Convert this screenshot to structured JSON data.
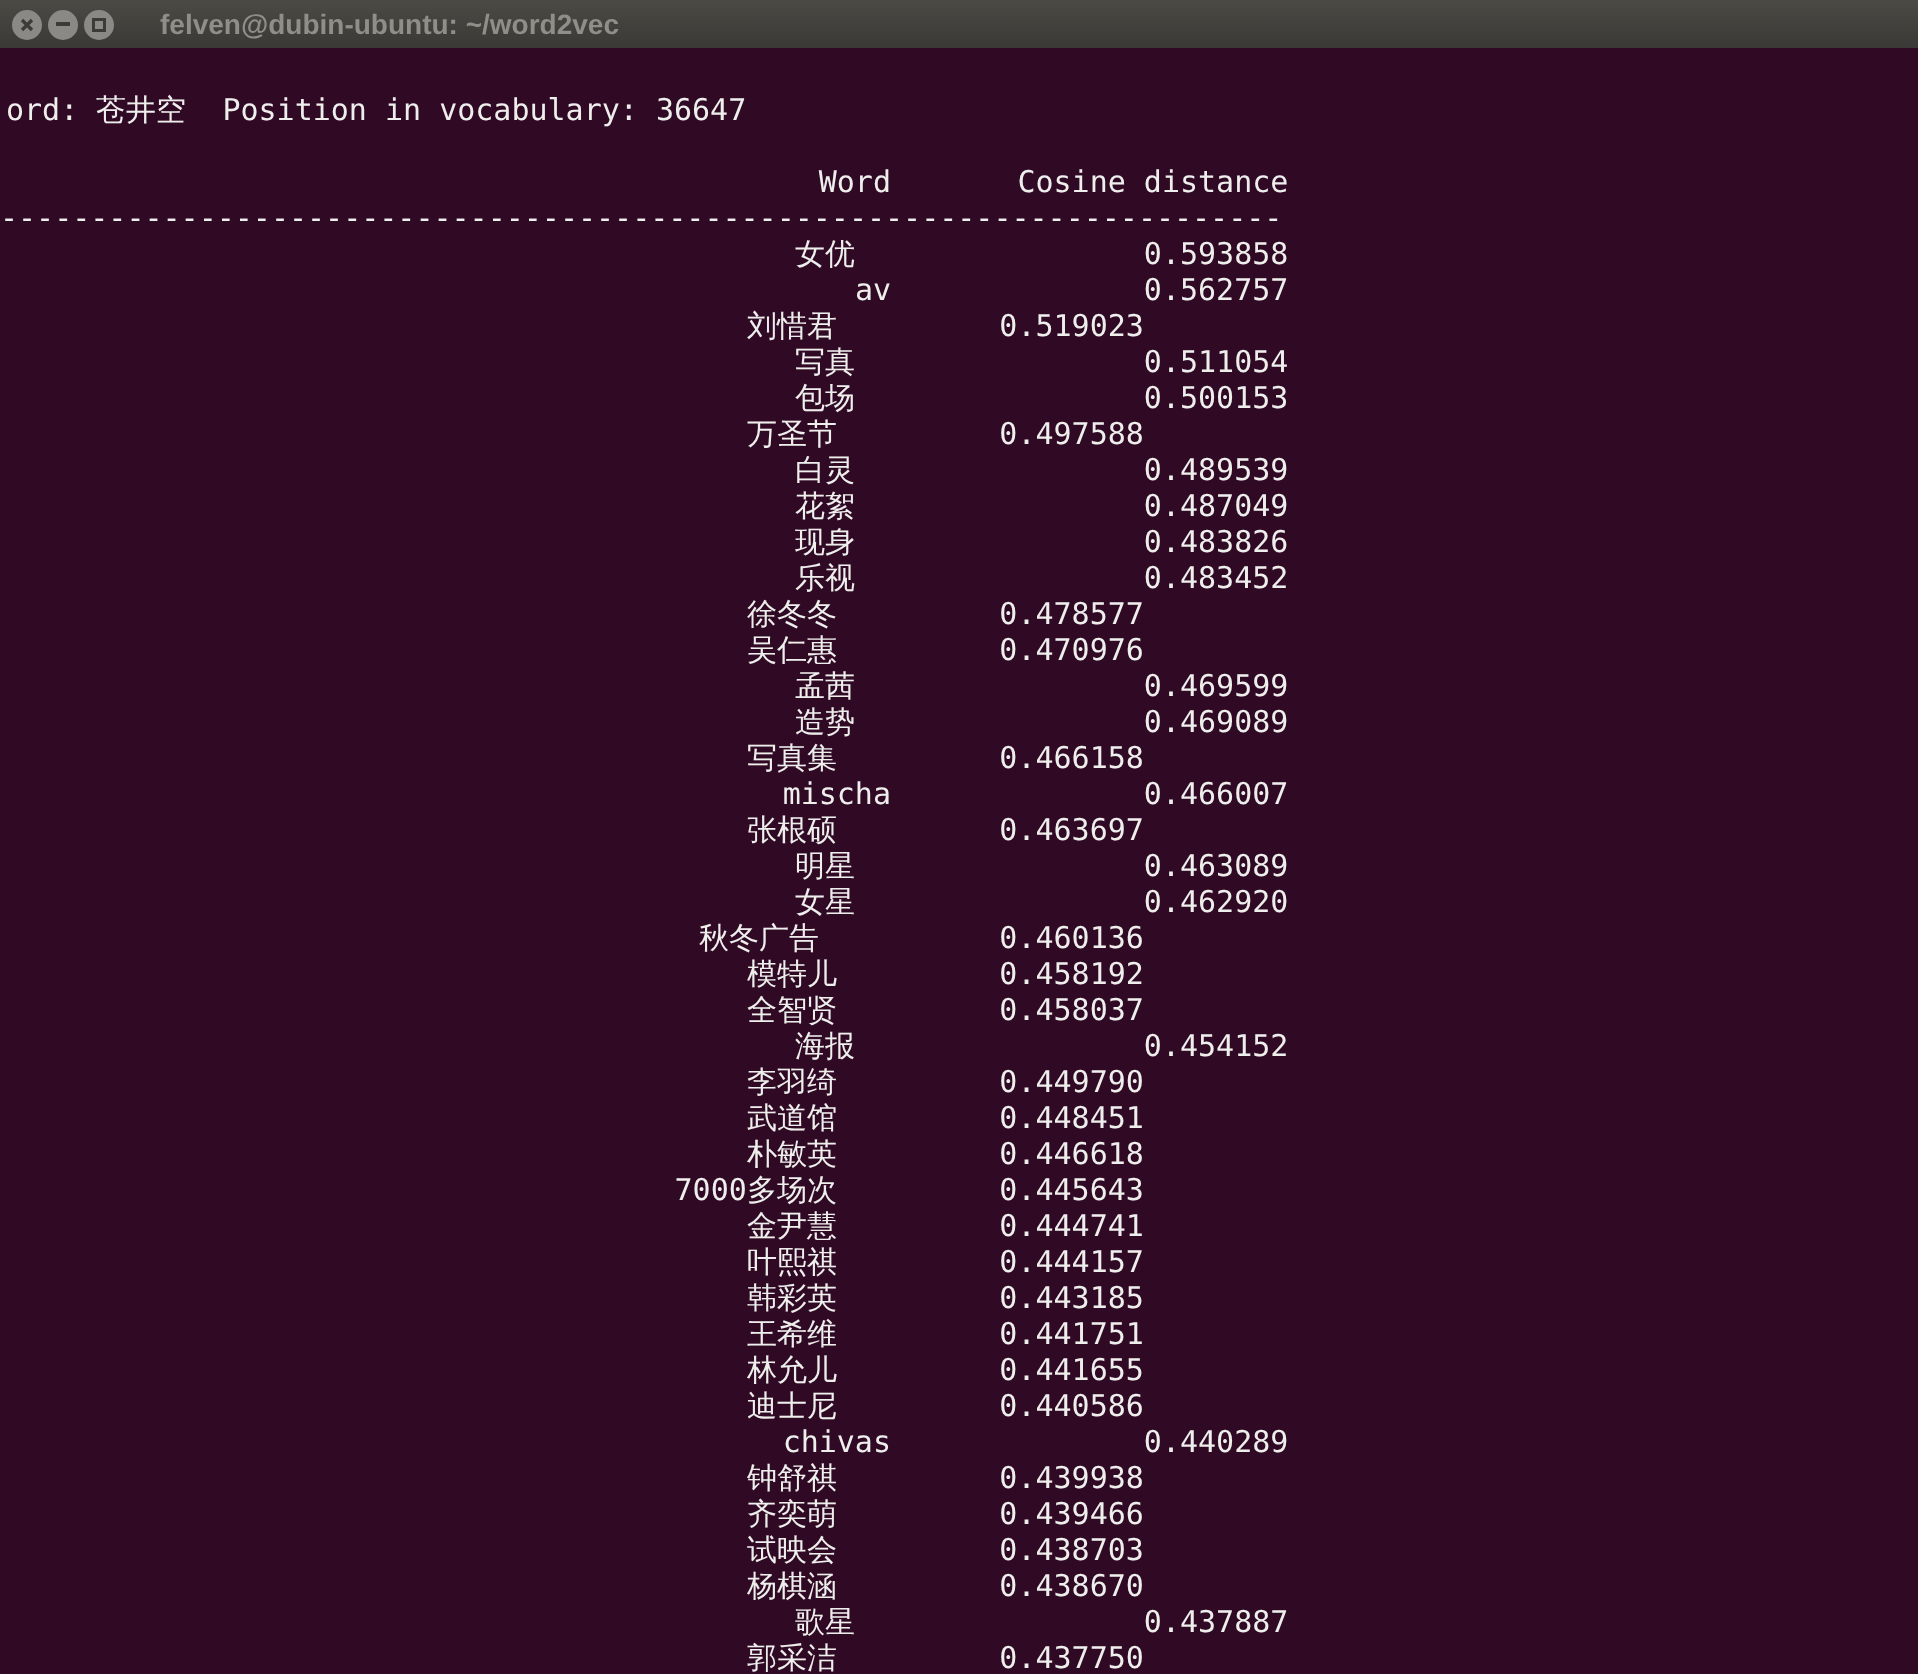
{
  "window": {
    "title": "felven@dubin-ubuntu: ~/word2vec"
  },
  "terminal": {
    "query_line": "ord: 苍井空  Position in vocabulary: 36647",
    "columns": [
      "Word",
      "Cosine distance"
    ],
    "separator": "-----------------------------------------------------------------------",
    "rows": [
      {
        "word": "女优",
        "distance": "0.593858"
      },
      {
        "word": "av",
        "distance": "0.562757"
      },
      {
        "word": "刘惜君",
        "distance": "0.519023"
      },
      {
        "word": "写真",
        "distance": "0.511054"
      },
      {
        "word": "包场",
        "distance": "0.500153"
      },
      {
        "word": "万圣节",
        "distance": "0.497588"
      },
      {
        "word": "白灵",
        "distance": "0.489539"
      },
      {
        "word": "花絮",
        "distance": "0.487049"
      },
      {
        "word": "现身",
        "distance": "0.483826"
      },
      {
        "word": "乐视",
        "distance": "0.483452"
      },
      {
        "word": "徐冬冬",
        "distance": "0.478577"
      },
      {
        "word": "吴仁惠",
        "distance": "0.470976"
      },
      {
        "word": "孟茜",
        "distance": "0.469599"
      },
      {
        "word": "造势",
        "distance": "0.469089"
      },
      {
        "word": "写真集",
        "distance": "0.466158"
      },
      {
        "word": "mischa",
        "distance": "0.466007"
      },
      {
        "word": "张根硕",
        "distance": "0.463697"
      },
      {
        "word": "明星",
        "distance": "0.463089"
      },
      {
        "word": "女星",
        "distance": "0.462920"
      },
      {
        "word": "秋冬广告",
        "distance": "0.460136"
      },
      {
        "word": "模特儿",
        "distance": "0.458192"
      },
      {
        "word": "全智贤",
        "distance": "0.458037"
      },
      {
        "word": "海报",
        "distance": "0.454152"
      },
      {
        "word": "李羽绮",
        "distance": "0.449790"
      },
      {
        "word": "武道馆",
        "distance": "0.448451"
      },
      {
        "word": "朴敏英",
        "distance": "0.446618"
      },
      {
        "word": "7000多场次",
        "distance": "0.445643"
      },
      {
        "word": "金尹慧",
        "distance": "0.444741"
      },
      {
        "word": "叶熙祺",
        "distance": "0.444157"
      },
      {
        "word": "韩彩英",
        "distance": "0.443185"
      },
      {
        "word": "王希维",
        "distance": "0.441751"
      },
      {
        "word": "林允儿",
        "distance": "0.441655"
      },
      {
        "word": "迪士尼",
        "distance": "0.440586"
      },
      {
        "word": "chivas",
        "distance": "0.440289"
      },
      {
        "word": "钟舒祺",
        "distance": "0.439938"
      },
      {
        "word": "齐奕萌",
        "distance": "0.439466"
      },
      {
        "word": "试映会",
        "distance": "0.438703"
      },
      {
        "word": "杨棋涵",
        "distance": "0.438670"
      },
      {
        "word": "歌星",
        "distance": "0.437887"
      },
      {
        "word": "郭采洁",
        "distance": "0.437750"
      }
    ]
  }
}
